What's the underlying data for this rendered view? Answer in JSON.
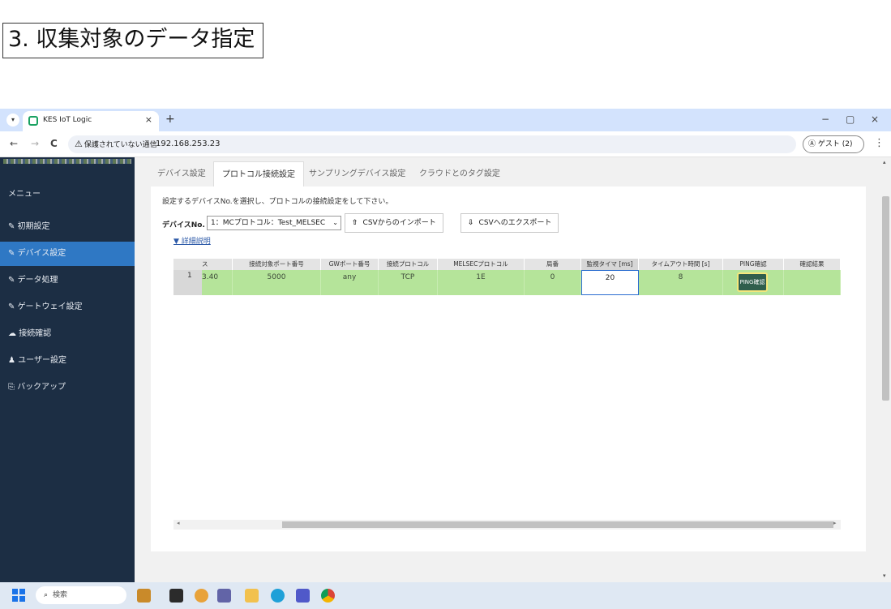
{
  "slide": {
    "title": "3. 収集対象のデータ指定"
  },
  "browser": {
    "tab_title": "KES IoT Logic",
    "tab_close": "×",
    "new_tab": "+",
    "security_warning": "保護されていない通信",
    "url": "192.168.253.23",
    "profile": "ゲスト (2)",
    "nav": {
      "back": "←",
      "forward": "→",
      "reload": "C"
    },
    "window": {
      "minimize": "−",
      "restore": "▢",
      "close": "×"
    },
    "kebab": "⋮"
  },
  "sidebar": {
    "menu_label": "メニュー",
    "items": [
      {
        "label": "初期設定",
        "icon": "edit-icon"
      },
      {
        "label": "デバイス設定",
        "icon": "edit-icon"
      },
      {
        "label": "データ処理",
        "icon": "edit-icon"
      },
      {
        "label": "ゲートウェイ設定",
        "icon": "edit-icon"
      },
      {
        "label": "接続確認",
        "icon": "cloud-icon"
      },
      {
        "label": "ユーザー設定",
        "icon": "user-icon"
      },
      {
        "label": "バックアップ",
        "icon": "backup-icon"
      }
    ],
    "active_index": 1
  },
  "tabs": [
    {
      "label": "デバイス設定"
    },
    {
      "label": "プロトコル接続設定"
    },
    {
      "label": "サンプリングデバイス設定"
    },
    {
      "label": "クラウドとのタグ設定"
    }
  ],
  "active_tab": 1,
  "panel": {
    "instruction": "設定するデバイスNo.を選択し、プロトコルの接続設定をして下さい。",
    "device_label": "デバイスNo.",
    "device_select": "1：MCプロトコル：Test_MELSEC",
    "import_button": "CSVからのインポート",
    "export_button": "CSVへのエクスポート",
    "detail_link": "▼ 詳細説明"
  },
  "grid": {
    "columns": [
      "ス",
      "接続対象ポート番号",
      "GWポート番号",
      "接続プロトコル",
      "MELSECプロトコル",
      "局番",
      "監視タイマ [ms]",
      "タイムアウト時間 [s]",
      "PING確認",
      "確認結果"
    ],
    "rows": [
      {
        "row_no": "1",
        "cells": [
          "3.40",
          "5000",
          "any",
          "TCP",
          "1E",
          "0",
          "20",
          "8",
          "",
          ""
        ]
      }
    ],
    "ping_button": "PING確認"
  },
  "taskbar": {
    "search_placeholder": "検索",
    "search_icon": "magnifier-icon"
  }
}
